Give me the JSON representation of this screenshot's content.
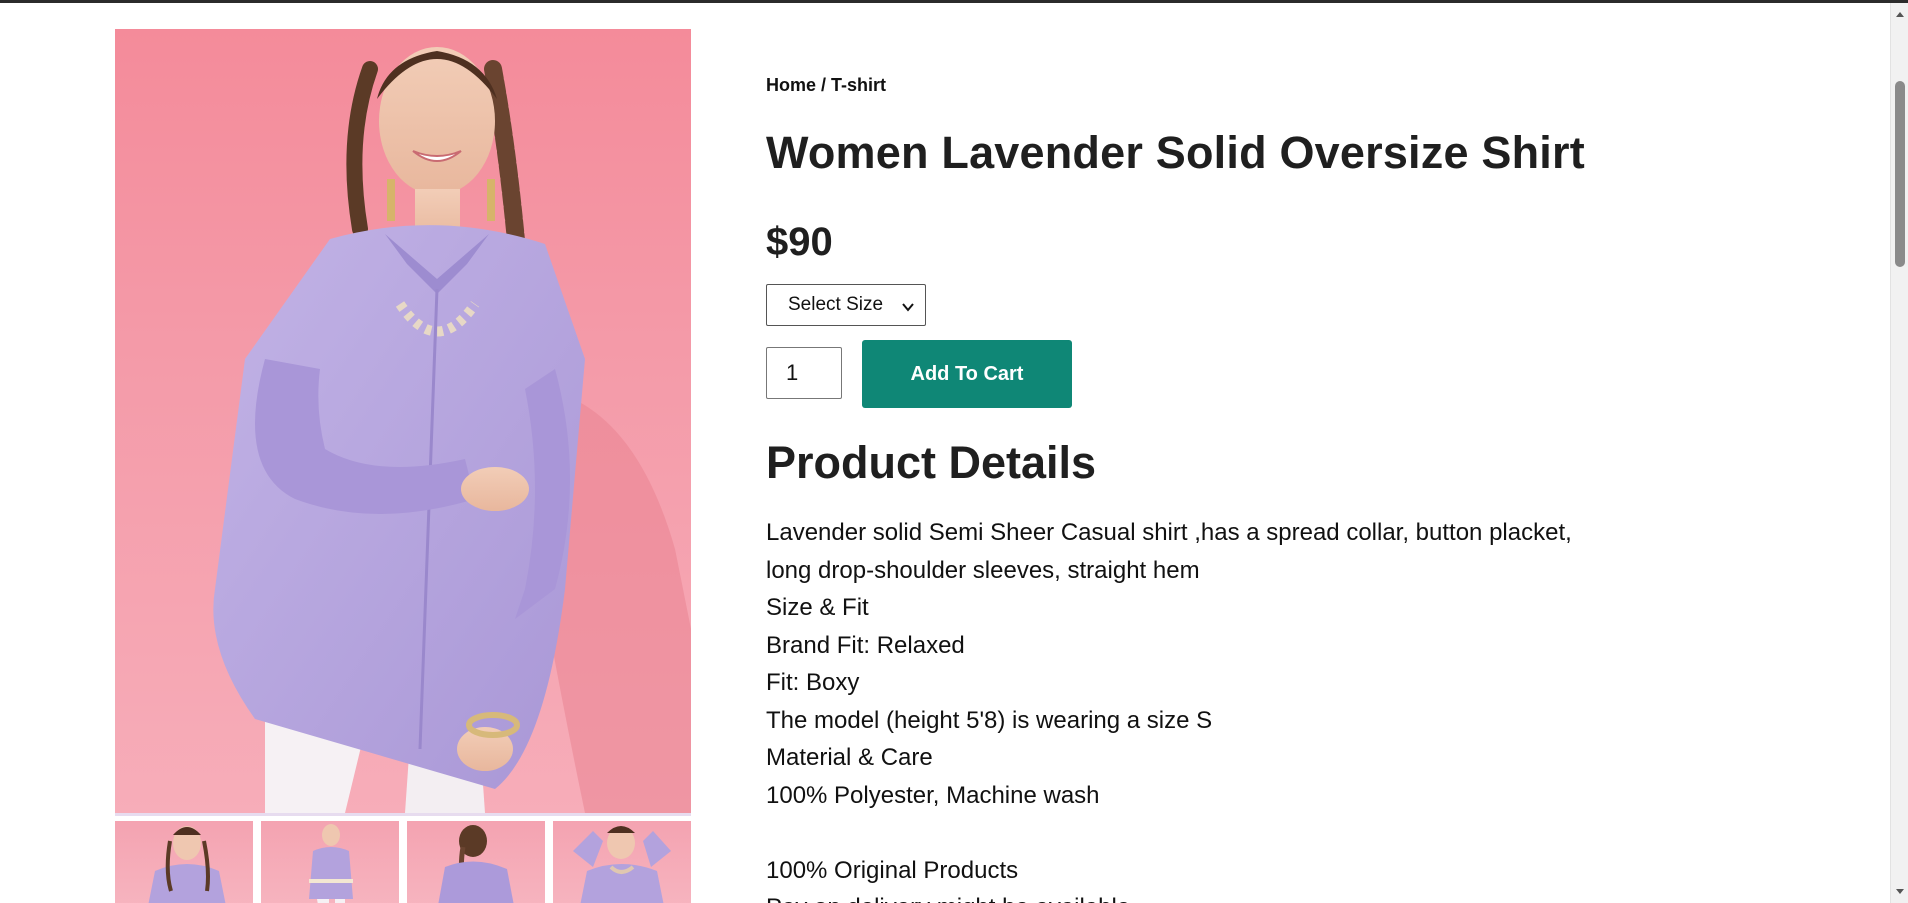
{
  "breadcrumb": {
    "home": "Home",
    "separator": " / ",
    "current": "T-shirt"
  },
  "product": {
    "title": "Women Lavender Solid Oversize Shirt",
    "price": "$90",
    "size_select": {
      "selected": "Select Size"
    },
    "quantity": "1",
    "add_to_cart_label": "Add To Cart",
    "accent_color": "#0f8776",
    "shirt_color": "#b7a6dd",
    "background_color": "#f49aa8"
  },
  "details": {
    "heading": "Product Details",
    "lines": [
      "Lavender solid Semi Sheer Casual shirt ,has a spread collar, button placket,",
      "long drop-shoulder sleeves, straight hem",
      "Size & Fit",
      "Brand Fit: Relaxed",
      "Fit: Boxy",
      "The model (height 5'8) is wearing a size S",
      "Material & Care",
      "100% Polyester, Machine wash"
    ],
    "extra_lines": [
      "100% Original Products",
      "Pay on delivery might be available"
    ]
  },
  "gallery": {
    "main_image": "model-lavender-shirt-photo",
    "thumbnails": [
      "thumbnail-front-smile",
      "thumbnail-full-length-belt",
      "thumbnail-back-view",
      "thumbnail-arms-raised"
    ]
  },
  "icons": {
    "select": "chevron-down-icon",
    "scroll_up": "scroll-up-arrow-icon",
    "scroll_down": "scroll-down-arrow-icon"
  }
}
